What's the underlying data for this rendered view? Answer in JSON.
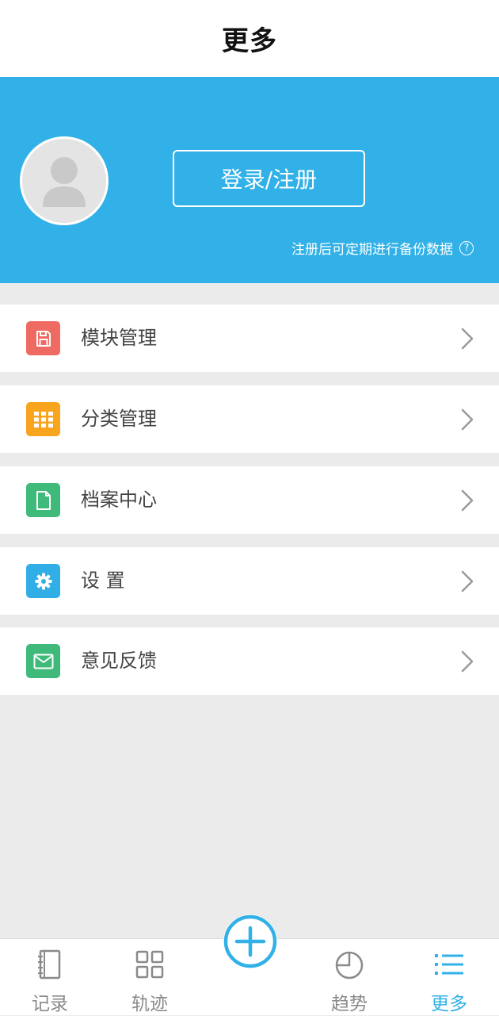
{
  "header": {
    "title": "更多"
  },
  "banner": {
    "login_label": "登录/注册",
    "note": "注册后可定期进行备份数据",
    "help_glyph": "?"
  },
  "menu": [
    {
      "label": "模块管理",
      "icon": "save-icon",
      "color": "#ee6a62"
    },
    {
      "label": "分类管理",
      "icon": "grid-icon",
      "color": "#f8a41c"
    },
    {
      "label": "档案中心",
      "icon": "document-icon",
      "color": "#3fba7a"
    },
    {
      "label": "设 置",
      "icon": "gear-icon",
      "color": "#32aee6"
    },
    {
      "label": "意见反馈",
      "icon": "mail-icon",
      "color": "#3fba7a"
    }
  ],
  "tabs": [
    {
      "label": "记录",
      "icon": "notebook-icon"
    },
    {
      "label": "轨迹",
      "icon": "grid-four-icon"
    },
    {
      "label": "趋势",
      "icon": "pie-chart-icon"
    },
    {
      "label": "更多",
      "icon": "list-icon",
      "active": true
    }
  ],
  "colors": {
    "accent": "#31b1e7",
    "tab_inactive": "#8a8a8a"
  }
}
